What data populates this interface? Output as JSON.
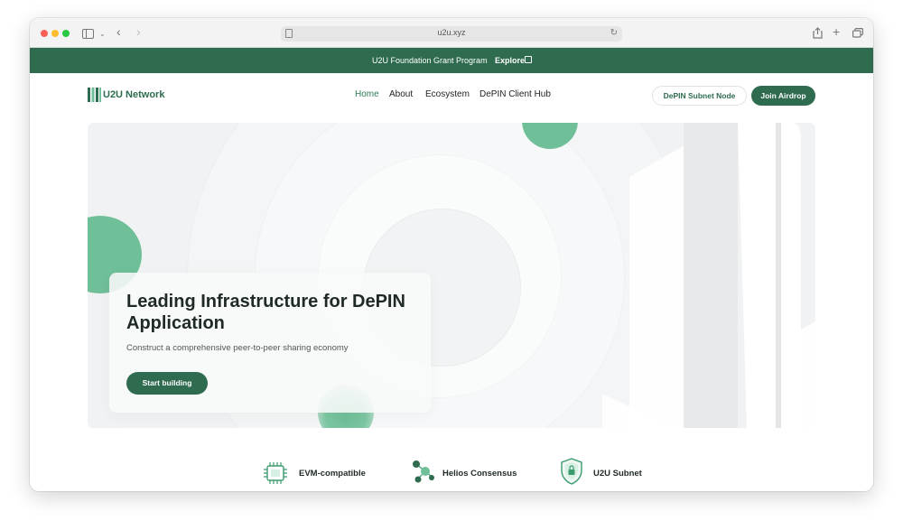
{
  "browser": {
    "url": "u2u.xyz"
  },
  "banner": {
    "text": "U2U Foundation Grant Program",
    "link": "Explore"
  },
  "nav": {
    "logo": "U2U Network",
    "links": [
      "Home",
      "About",
      "Ecosystem",
      "DePIN Client Hub"
    ],
    "buttons": {
      "subnet": "DePIN Subnet Node",
      "airdrop": "Join Airdrop"
    }
  },
  "hero": {
    "title": "Leading Infrastructure for DePIN Application",
    "subtitle": "Construct a comprehensive peer-to-peer sharing economy",
    "cta": "Start building"
  },
  "features": [
    {
      "label": "EVM-compatible",
      "icon": "chip-icon"
    },
    {
      "label": "Helios Consensus",
      "icon": "nodes-icon"
    },
    {
      "label": "U2U Subnet",
      "icon": "shield-icon"
    }
  ],
  "colors": {
    "brand": "#2e6b4f",
    "accent": "#6fbf98"
  }
}
